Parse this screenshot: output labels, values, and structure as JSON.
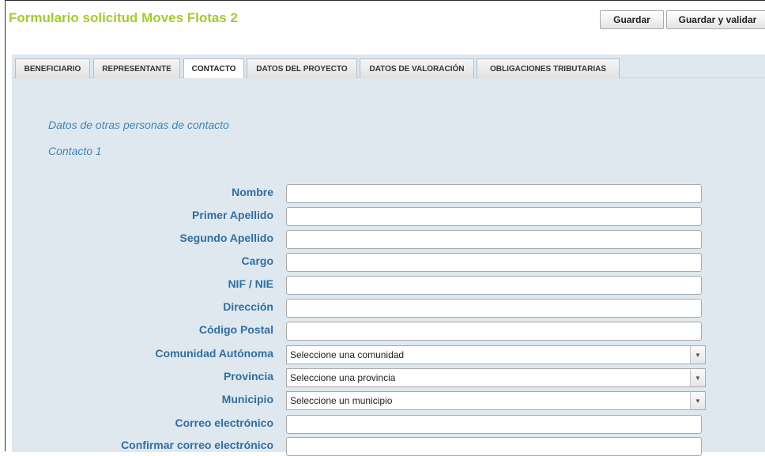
{
  "header": {
    "title": "Formulario solicitud Moves Flotas 2",
    "save_label": "Guardar",
    "save_validate_label": "Guardar y validar"
  },
  "tabs": [
    {
      "label": "BENEFICIARIO"
    },
    {
      "label": "REPRESENTANTE"
    },
    {
      "label": "CONTACTO",
      "active": true
    },
    {
      "label": "DATOS DEL PROYECTO"
    },
    {
      "label": "DATOS DE VALORACIÓN"
    },
    {
      "label": "OBLIGACIONES TRIBUTARIAS"
    }
  ],
  "section": {
    "title": "Datos de otras personas de contacto",
    "subtitle": "Contacto 1"
  },
  "fields": {
    "nombre": {
      "label": "Nombre",
      "value": ""
    },
    "primer_apellido": {
      "label": "Primer Apellido",
      "value": ""
    },
    "segundo_apellido": {
      "label": "Segundo Apellido",
      "value": ""
    },
    "cargo": {
      "label": "Cargo",
      "value": ""
    },
    "nif": {
      "label": "NIF / NIE",
      "value": ""
    },
    "direccion": {
      "label": "Dirección",
      "value": ""
    },
    "codigo_postal": {
      "label": "Código Postal",
      "value": ""
    },
    "comunidad": {
      "label": "Comunidad Autónoma",
      "selected": "Seleccione una comunidad"
    },
    "provincia": {
      "label": "Provincia",
      "selected": "Seleccione una provincia"
    },
    "municipio": {
      "label": "Municipio",
      "selected": "Seleccione un municipio"
    },
    "correo": {
      "label": "Correo electrónico",
      "value": ""
    },
    "confirmar_correo": {
      "label": "Confirmar correo electrónico",
      "value": ""
    }
  },
  "icons": {
    "select_arrow": "chevron-down-icon"
  },
  "colors": {
    "title": "#a6c92e",
    "label": "#2e6ea5",
    "section": "#3f86b8",
    "panel": "#dfe8ef"
  }
}
